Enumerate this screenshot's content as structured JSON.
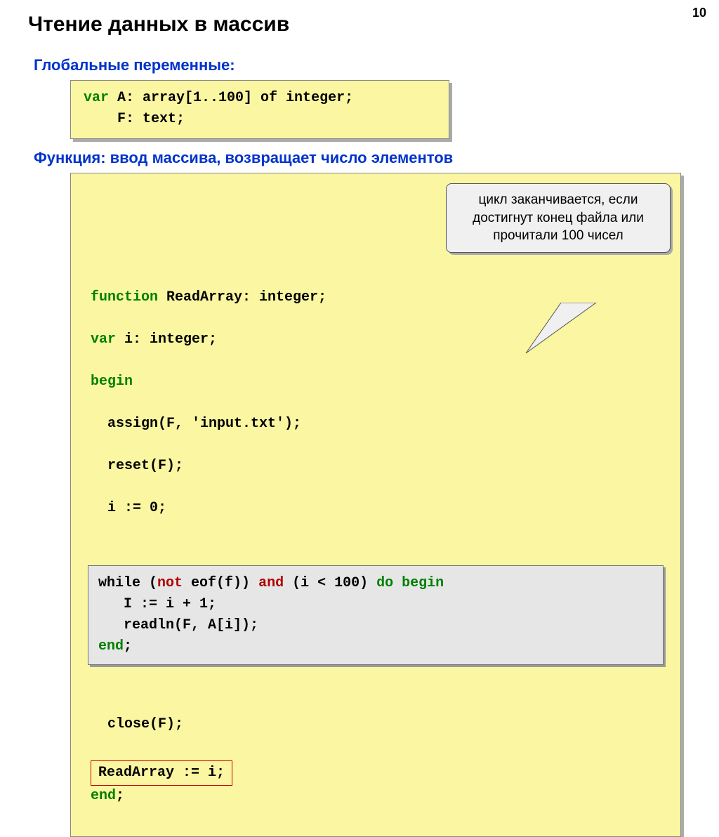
{
  "page_number": "10",
  "title": "Чтение данных в массив",
  "sections": {
    "globals_heading": "Глобальные переменные:",
    "function_heading": "Функция: ввод массива, возвращает число элементов"
  },
  "globals_code": {
    "kw_var": "var",
    "line1_rest": " A: array[1..100] of integer;",
    "line2": "    F: text;"
  },
  "fn_code": {
    "kw_function": "function",
    "sig_rest": " ReadArray: integer;",
    "kw_var": "var",
    "var_rest": " i: integer;",
    "kw_begin": "begin",
    "assign": "  assign(F, 'input.txt');",
    "reset": "  reset(F);",
    "i0": "  i := 0;",
    "inner": {
      "while_pre": "while (",
      "kw_not": "not",
      "while_mid": " eof(f)) ",
      "kw_and": "and",
      "while_post": " (i < 100) ",
      "kw_do": "do",
      "kw_begin": " begin",
      "inc": "   I := i + 1;",
      "readln": "   readln(F, A[i]);",
      "kw_end": "end",
      "semi": ";"
    },
    "close": "  close(F);",
    "return_stmt": "ReadArray := i;",
    "kw_end": "end",
    "end_semi": ";"
  },
  "callout_text": "цикл заканчивается, если достигнут конец файла или прочитали 100 чисел"
}
